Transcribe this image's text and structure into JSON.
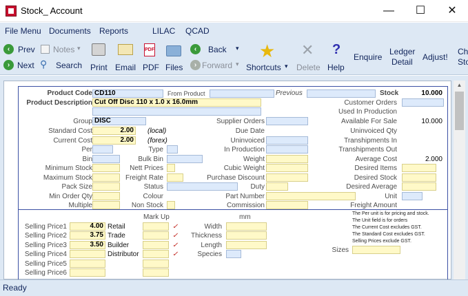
{
  "window": {
    "title": "Stock_ Account",
    "minimize": "—",
    "maximize": "☐",
    "close": "✕"
  },
  "menu": [
    "File Menu",
    "Documents",
    "Reports",
    "LILAC",
    "QCAD"
  ],
  "toolbar": {
    "prev": "Prev",
    "notes": "Notes",
    "next": "Next",
    "search": "Search",
    "print": "Print",
    "email": "Email",
    "pdf": "PDF",
    "files": "Files",
    "back": "Back",
    "forward": "Forward",
    "shortcuts": "Shortcuts",
    "delete": "Delete",
    "help": "Help",
    "enquire": "Enquire",
    "ledger1": "Ledger",
    "ledger2": "Detail",
    "adjust": "Adjust!",
    "clip1": "Ch",
    "clip2": "Sto",
    "pdf_icon_text": "PDF"
  },
  "form": {
    "product_code_label": "Product Code",
    "product_code": "CD110",
    "from_product_label": "From Product",
    "previous_label": "Previous",
    "stock_label": "Stock",
    "stock": "10.000",
    "product_desc_label": "Product Description",
    "product_desc": "Cut Off Disc 110 x 1.0 x 16.0mm",
    "customer_orders": "Customer Orders",
    "used_in_production": "Used In Production",
    "group_label": "Group",
    "group": "DISC",
    "supplier_orders": "Supplier Orders",
    "available_for_sale": "Available For Sale",
    "available": "10.000",
    "standard_cost_label": "Standard Cost",
    "standard_cost": "2.00",
    "local": "(local)",
    "due_date": "Due Date",
    "uninvoiced_qty": "Uninvoiced Qty",
    "current_cost_label": "Current Cost",
    "current_cost": "2.00",
    "forex": "(forex)",
    "uninvoiced": "Uninvoiced",
    "transhipments_in": "Transhipments In",
    "per": "Per",
    "type": "Type",
    "in_production": "In Production",
    "transhipments_out": "Transhipments Out",
    "bin": "Bin",
    "bulk_bin": "Bulk Bin",
    "weight": "Weight",
    "average_cost_label": "Average Cost",
    "average_cost": "2.000",
    "minimum_stock": "Minimum Stock",
    "nett_prices": "Nett Prices",
    "cubic_weight": "Cubic Weight",
    "desired_items": "Desired Items",
    "maximum_stock": "Maximum Stock",
    "freight_rate": "Freight Rate",
    "purchase_discount": "Purchase Discount",
    "desired_stock": "Desired Stock",
    "pack_size": "Pack Size",
    "status": "Status",
    "duty": "Duty",
    "desired_average": "Desired Average",
    "min_order_qty": "Min Order Qty",
    "colour": "Colour",
    "part_number": "Part Number",
    "unit": "Unit",
    "multiple": "Multiple",
    "non_stock": "Non Stock",
    "commission": "Commission",
    "freight_amount": "Freight Amount"
  },
  "pricing": {
    "mark_up": "Mark Up",
    "mm": "mm",
    "prices": [
      {
        "label": "Selling Price1",
        "value": "4.00",
        "name": "Retail"
      },
      {
        "label": "Selling Price2",
        "value": "3.75",
        "name": "Trade"
      },
      {
        "label": "Selling Price3",
        "value": "3.50",
        "name": "Builder"
      },
      {
        "label": "Selling Price4",
        "value": "",
        "name": "Distributor"
      },
      {
        "label": "Selling Price5",
        "value": "",
        "name": ""
      },
      {
        "label": "Selling Price6",
        "value": "",
        "name": ""
      }
    ],
    "tick": "✓",
    "width": "Width",
    "thickness": "Thickness",
    "length": "Length",
    "species": "Species",
    "sizes": "Sizes",
    "notes": [
      "The Per unit is for pricing and stock.",
      "The Unit field is for orders",
      "The Current Cost excludes GST.",
      "The Standard Cost excludes GST.",
      "Selling Prices exclude GST."
    ]
  },
  "status": "Ready"
}
